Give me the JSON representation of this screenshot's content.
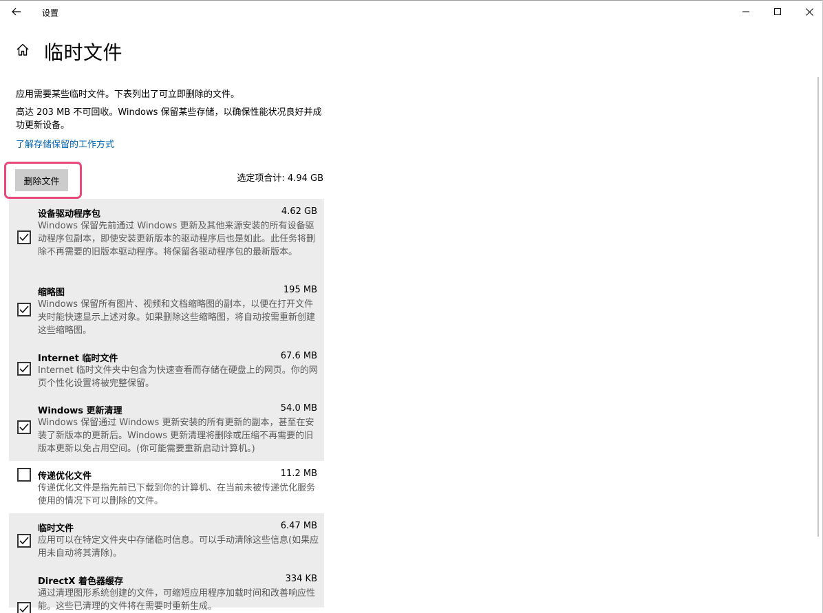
{
  "window": {
    "title": "设置"
  },
  "page": {
    "title": "临时文件",
    "description1": "应用需要某些临时文件。下表列出了可立即删除的文件。",
    "description2": "高达 203 MB 不可回收。Windows 保留某些存储，以确保性能状况良好并成功更新设备。",
    "learn_link": "了解存储保留的工作方式",
    "delete_button": "删除文件",
    "total_selected": "选定项合计: 4.94 GB"
  },
  "accent_color": "#0063b1",
  "highlight_color": "#e8497a",
  "files": [
    {
      "name": "设备驱动程序包",
      "size": "4.62 GB",
      "checked": true,
      "description": "Windows 保留先前通过 Windows 更新及其他来源安装的所有设备驱动程序包副本，即使安装更新版本的驱动程序后也是如此。此任务将删除不再需要的旧版本驱动程序。将保留各驱动程序包的最新版本。"
    },
    {
      "name": "缩略图",
      "size": "195 MB",
      "checked": true,
      "description": "Windows 保留所有图片、视频和文档缩略图的副本，以便在打开文件夹时能快速显示上述对象。如果删除这些缩略图，将自动按需重新创建这些缩略图。"
    },
    {
      "name": "Internet 临时文件",
      "size": "67.6 MB",
      "checked": true,
      "description": "Internet 临时文件夹中包含为快速查看而存储在硬盘上的网页。你的网页个性化设置将被完整保留。"
    },
    {
      "name": "Windows 更新清理",
      "size": "54.0 MB",
      "checked": true,
      "description": "Windows 保留通过 Windows 更新安装的所有更新的副本，甚至在安装了新版本的更新后。Windows 更新清理将删除或压缩不再需要的旧版本更新以免占用空间。(你可能需要重新启动计算机。)"
    },
    {
      "name": "传递优化文件",
      "size": "11.2 MB",
      "checked": false,
      "description": "传递优化文件是指先前已下载到你的计算机、在当前未被传递优化服务使用的情况下可以删除的文件。"
    },
    {
      "name": "临时文件",
      "size": "6.47 MB",
      "checked": true,
      "description": "应用可以在特定文件夹中存储临时信息。可以手动清除这些信息(如果应用未自动将其清除)。"
    },
    {
      "name": "DirectX 着色器缓存",
      "size": "334 KB",
      "checked": true,
      "description": "通过清理图形系统创建的文件，可缩短应用程序加载时间和改善响应性能。这些已清理的文件将在需要时重新生成。"
    }
  ]
}
